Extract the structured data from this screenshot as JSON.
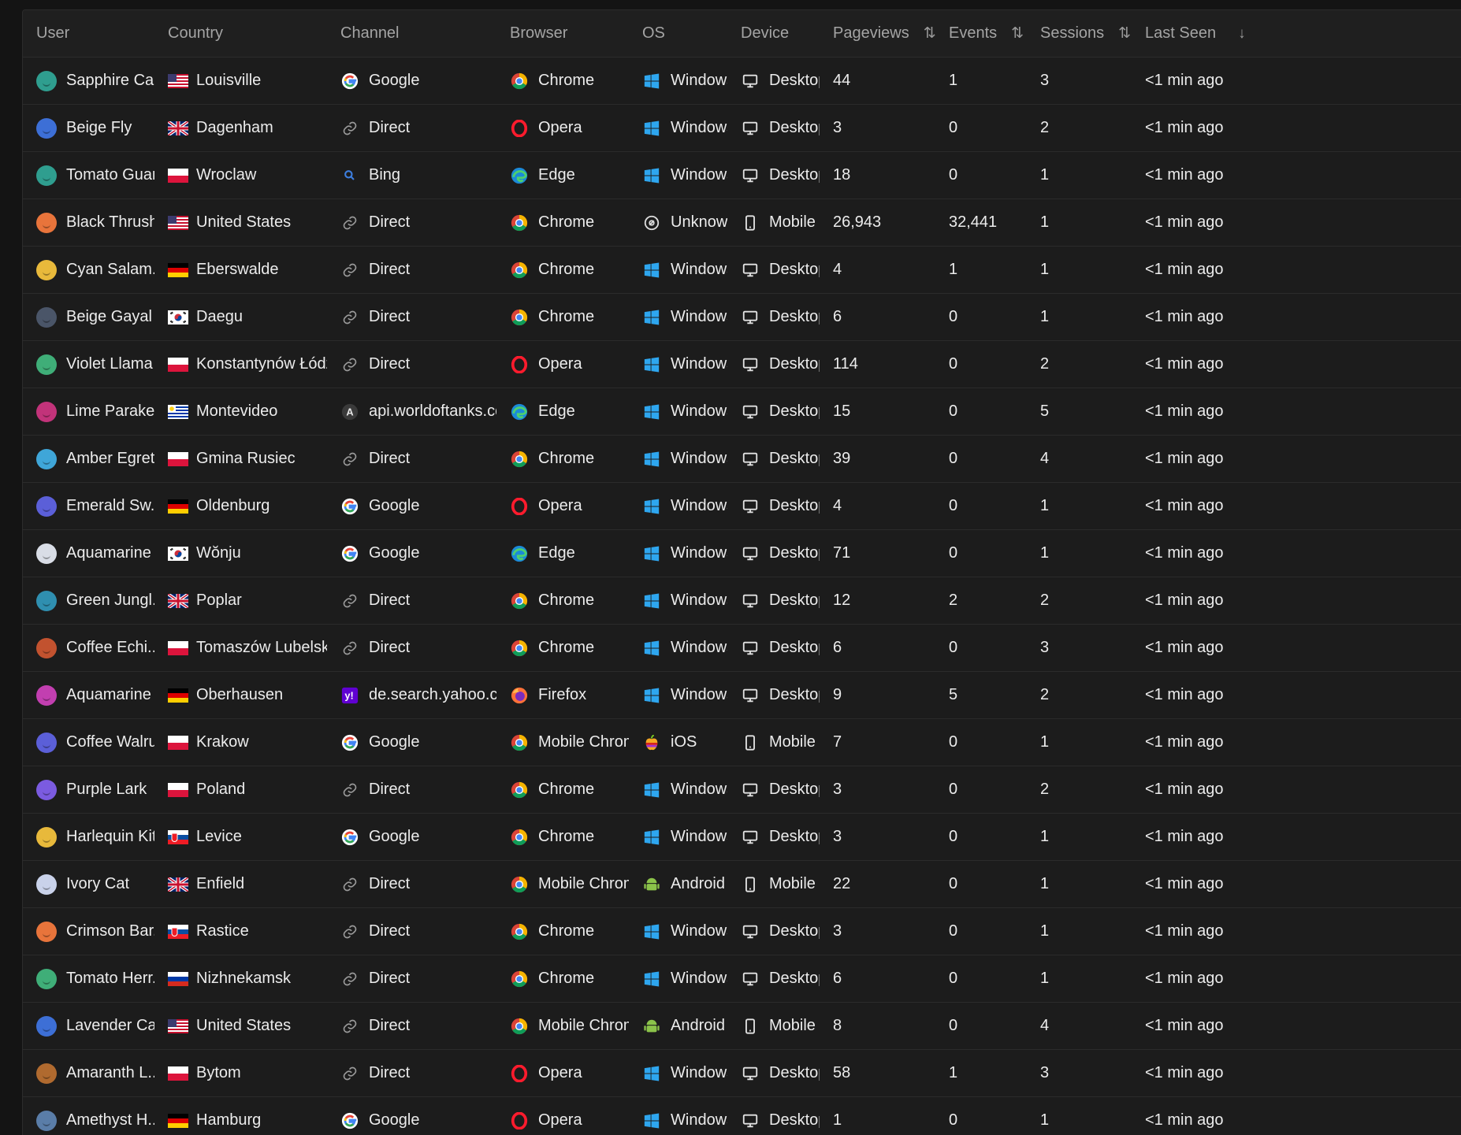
{
  "columns": {
    "user": "User",
    "country": "Country",
    "channel": "Channel",
    "browser": "Browser",
    "os": "OS",
    "device": "Device",
    "pageviews": "Pageviews",
    "events": "Events",
    "sessions": "Sessions",
    "last_seen": "Last Seen"
  },
  "sort_icons": {
    "pageviews": "sort-both-icon",
    "events": "sort-both-icon",
    "sessions": "sort-both-icon",
    "last_seen": "sort-desc-icon"
  },
  "rows": [
    {
      "user": "Sapphire Ca...",
      "avatar_color": "#2f9e8f",
      "flag": "us",
      "country": "Louisville",
      "channel": "Google",
      "channel_icon": "google",
      "browser": "Chrome",
      "browser_icon": "chrome",
      "os": "Windows",
      "os_icon": "windows",
      "device": "Desktop",
      "device_icon": "desktop",
      "pageviews": "44",
      "events": "1",
      "sessions": "3",
      "last_seen": "<1 min ago"
    },
    {
      "user": "Beige Fly",
      "avatar_color": "#3d6fd6",
      "flag": "gb",
      "country": "Dagenham",
      "channel": "Direct",
      "channel_icon": "link",
      "browser": "Opera",
      "browser_icon": "opera",
      "os": "Windows",
      "os_icon": "windows",
      "device": "Desktop",
      "device_icon": "desktop",
      "pageviews": "3",
      "events": "0",
      "sessions": "2",
      "last_seen": "<1 min ago"
    },
    {
      "user": "Tomato Guan",
      "avatar_color": "#2f9e8f",
      "flag": "pl",
      "country": "Wroclaw",
      "channel": "Bing",
      "channel_icon": "bing",
      "browser": "Edge",
      "browser_icon": "edge",
      "os": "Windows",
      "os_icon": "windows",
      "device": "Desktop",
      "device_icon": "desktop",
      "pageviews": "18",
      "events": "0",
      "sessions": "1",
      "last_seen": "<1 min ago"
    },
    {
      "user": "Black Thrush",
      "avatar_color": "#e8743b",
      "flag": "us",
      "country": "United States",
      "channel": "Direct",
      "channel_icon": "link",
      "browser": "Chrome",
      "browser_icon": "chrome",
      "os": "Unknown",
      "os_icon": "unknown",
      "device": "Mobile",
      "device_icon": "mobile",
      "pageviews": "26,943",
      "events": "32,441",
      "sessions": "1",
      "last_seen": "<1 min ago"
    },
    {
      "user": "Cyan Salam...",
      "avatar_color": "#e8b93b",
      "flag": "de",
      "country": "Eberswalde",
      "channel": "Direct",
      "channel_icon": "link",
      "browser": "Chrome",
      "browser_icon": "chrome",
      "os": "Windows",
      "os_icon": "windows",
      "device": "Desktop",
      "device_icon": "desktop",
      "pageviews": "4",
      "events": "1",
      "sessions": "1",
      "last_seen": "<1 min ago"
    },
    {
      "user": "Beige Gayal",
      "avatar_color": "#4a5568",
      "flag": "kr",
      "country": "Daegu",
      "channel": "Direct",
      "channel_icon": "link",
      "browser": "Chrome",
      "browser_icon": "chrome",
      "os": "Windows",
      "os_icon": "windows",
      "device": "Desktop",
      "device_icon": "desktop",
      "pageviews": "6",
      "events": "0",
      "sessions": "1",
      "last_seen": "<1 min ago"
    },
    {
      "user": "Violet Llama",
      "avatar_color": "#3fae78",
      "flag": "pl",
      "country": "Konstantynów Łódzki",
      "channel": "Direct",
      "channel_icon": "link",
      "browser": "Opera",
      "browser_icon": "opera",
      "os": "Windows",
      "os_icon": "windows",
      "device": "Desktop",
      "device_icon": "desktop",
      "pageviews": "114",
      "events": "0",
      "sessions": "2",
      "last_seen": "<1 min ago"
    },
    {
      "user": "Lime Parakeet",
      "avatar_color": "#c2337a",
      "flag": "uy",
      "country": "Montevideo",
      "channel": "api.worldoftanks.com",
      "channel_icon": "letter-a",
      "browser": "Edge",
      "browser_icon": "edge",
      "os": "Windows",
      "os_icon": "windows",
      "device": "Desktop",
      "device_icon": "desktop",
      "pageviews": "15",
      "events": "0",
      "sessions": "5",
      "last_seen": "<1 min ago"
    },
    {
      "user": "Amber Egret",
      "avatar_color": "#3fa6d8",
      "flag": "pl",
      "country": "Gmina Rusiec",
      "channel": "Direct",
      "channel_icon": "link",
      "browser": "Chrome",
      "browser_icon": "chrome",
      "os": "Windows",
      "os_icon": "windows",
      "device": "Desktop",
      "device_icon": "desktop",
      "pageviews": "39",
      "events": "0",
      "sessions": "4",
      "last_seen": "<1 min ago"
    },
    {
      "user": "Emerald Sw...",
      "avatar_color": "#5b5fd8",
      "flag": "de",
      "country": "Oldenburg",
      "channel": "Google",
      "channel_icon": "google",
      "browser": "Opera",
      "browser_icon": "opera",
      "os": "Windows",
      "os_icon": "windows",
      "device": "Desktop",
      "device_icon": "desktop",
      "pageviews": "4",
      "events": "0",
      "sessions": "1",
      "last_seen": "<1 min ago"
    },
    {
      "user": "Aquamarine ...",
      "avatar_color": "#d9dde6",
      "flag": "kr",
      "country": "Wŏnju",
      "channel": "Google",
      "channel_icon": "google",
      "browser": "Edge",
      "browser_icon": "edge",
      "os": "Windows",
      "os_icon": "windows",
      "device": "Desktop",
      "device_icon": "desktop",
      "pageviews": "71",
      "events": "0",
      "sessions": "1",
      "last_seen": "<1 min ago"
    },
    {
      "user": "Green Jungl...",
      "avatar_color": "#2f8fb0",
      "flag": "gb",
      "country": "Poplar",
      "channel": "Direct",
      "channel_icon": "link",
      "browser": "Chrome",
      "browser_icon": "chrome",
      "os": "Windows",
      "os_icon": "windows",
      "device": "Desktop",
      "device_icon": "desktop",
      "pageviews": "12",
      "events": "2",
      "sessions": "2",
      "last_seen": "<1 min ago"
    },
    {
      "user": "Coffee Echi...",
      "avatar_color": "#c2522f",
      "flag": "pl",
      "country": "Tomaszów Lubelski",
      "channel": "Direct",
      "channel_icon": "link",
      "browser": "Chrome",
      "browser_icon": "chrome",
      "os": "Windows",
      "os_icon": "windows",
      "device": "Desktop",
      "device_icon": "desktop",
      "pageviews": "6",
      "events": "0",
      "sessions": "3",
      "last_seen": "<1 min ago"
    },
    {
      "user": "Aquamarine ...",
      "avatar_color": "#c23fb0",
      "flag": "de",
      "country": "Oberhausen",
      "channel": "de.search.yahoo.com",
      "channel_icon": "yahoo",
      "browser": "Firefox",
      "browser_icon": "firefox",
      "os": "Windows",
      "os_icon": "windows",
      "device": "Desktop",
      "device_icon": "desktop",
      "pageviews": "9",
      "events": "5",
      "sessions": "2",
      "last_seen": "<1 min ago"
    },
    {
      "user": "Coffee Walrus",
      "avatar_color": "#5b5fd8",
      "flag": "pl",
      "country": "Krakow",
      "channel": "Google",
      "channel_icon": "google",
      "browser": "Mobile Chrome",
      "browser_icon": "chrome",
      "os": "iOS",
      "os_icon": "apple",
      "device": "Mobile",
      "device_icon": "mobile",
      "pageviews": "7",
      "events": "0",
      "sessions": "1",
      "last_seen": "<1 min ago"
    },
    {
      "user": "Purple Lark",
      "avatar_color": "#7b5be0",
      "flag": "pl",
      "country": "Poland",
      "channel": "Direct",
      "channel_icon": "link",
      "browser": "Chrome",
      "browser_icon": "chrome",
      "os": "Windows",
      "os_icon": "windows",
      "device": "Desktop",
      "device_icon": "desktop",
      "pageviews": "3",
      "events": "0",
      "sessions": "2",
      "last_seen": "<1 min ago"
    },
    {
      "user": "Harlequin Kite",
      "avatar_color": "#e8b93b",
      "flag": "sk",
      "country": "Levice",
      "channel": "Google",
      "channel_icon": "google",
      "browser": "Chrome",
      "browser_icon": "chrome",
      "os": "Windows",
      "os_icon": "windows",
      "device": "Desktop",
      "device_icon": "desktop",
      "pageviews": "3",
      "events": "0",
      "sessions": "1",
      "last_seen": "<1 min ago"
    },
    {
      "user": "Ivory Cat",
      "avatar_color": "#c9d2ea",
      "flag": "gb",
      "country": "Enfield",
      "channel": "Direct",
      "channel_icon": "link",
      "browser": "Mobile Chrome",
      "browser_icon": "chrome",
      "os": "Android",
      "os_icon": "android",
      "device": "Mobile",
      "device_icon": "mobile",
      "pageviews": "22",
      "events": "0",
      "sessions": "1",
      "last_seen": "<1 min ago"
    },
    {
      "user": "Crimson Bar...",
      "avatar_color": "#e8743b",
      "flag": "sk",
      "country": "Rastice",
      "channel": "Direct",
      "channel_icon": "link",
      "browser": "Chrome",
      "browser_icon": "chrome",
      "os": "Windows",
      "os_icon": "windows",
      "device": "Desktop",
      "device_icon": "desktop",
      "pageviews": "3",
      "events": "0",
      "sessions": "1",
      "last_seen": "<1 min ago"
    },
    {
      "user": "Tomato Herr...",
      "avatar_color": "#3fae78",
      "flag": "ru",
      "country": "Nizhnekamsk",
      "channel": "Direct",
      "channel_icon": "link",
      "browser": "Chrome",
      "browser_icon": "chrome",
      "os": "Windows",
      "os_icon": "windows",
      "device": "Desktop",
      "device_icon": "desktop",
      "pageviews": "6",
      "events": "0",
      "sessions": "1",
      "last_seen": "<1 min ago"
    },
    {
      "user": "Lavender Ca...",
      "avatar_color": "#3d6fd6",
      "flag": "us",
      "country": "United States",
      "channel": "Direct",
      "channel_icon": "link",
      "browser": "Mobile Chrome",
      "browser_icon": "chrome",
      "os": "Android",
      "os_icon": "android",
      "device": "Mobile",
      "device_icon": "mobile",
      "pageviews": "8",
      "events": "0",
      "sessions": "4",
      "last_seen": "<1 min ago"
    },
    {
      "user": "Amaranth L...",
      "avatar_color": "#b06a2f",
      "flag": "pl",
      "country": "Bytom",
      "channel": "Direct",
      "channel_icon": "link",
      "browser": "Opera",
      "browser_icon": "opera",
      "os": "Windows",
      "os_icon": "windows",
      "device": "Desktop",
      "device_icon": "desktop",
      "pageviews": "58",
      "events": "1",
      "sessions": "3",
      "last_seen": "<1 min ago"
    },
    {
      "user": "Amethyst H...",
      "avatar_color": "#5a7da8",
      "flag": "de",
      "country": "Hamburg",
      "channel": "Google",
      "channel_icon": "google",
      "browser": "Opera",
      "browser_icon": "opera",
      "os": "Windows",
      "os_icon": "windows",
      "device": "Desktop",
      "device_icon": "desktop",
      "pageviews": "1",
      "events": "0",
      "sessions": "1",
      "last_seen": "<1 min ago"
    }
  ]
}
